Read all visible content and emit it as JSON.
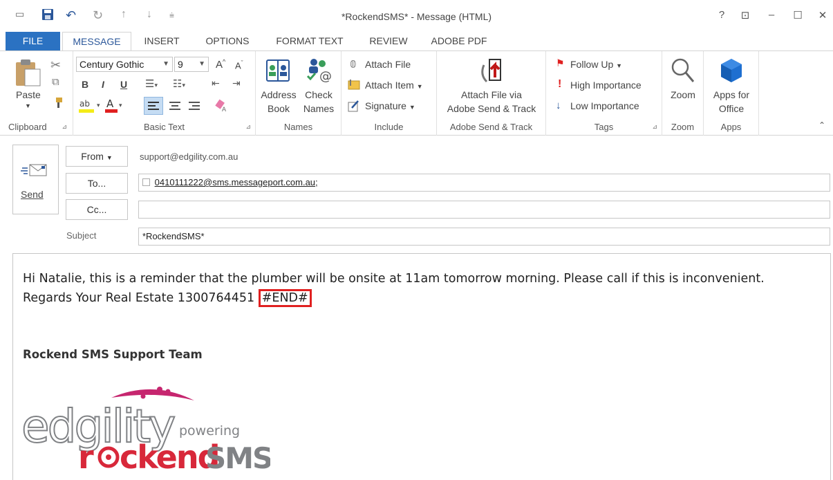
{
  "window": {
    "title": "*RockendSMS* - Message (HTML)",
    "help": "?",
    "restore": "⊡",
    "minimize": "–",
    "maximize": "☐",
    "close": "✕"
  },
  "tabs": [
    {
      "label": "FILE"
    },
    {
      "label": "MESSAGE"
    },
    {
      "label": "INSERT"
    },
    {
      "label": "OPTIONS"
    },
    {
      "label": "FORMAT TEXT"
    },
    {
      "label": "REVIEW"
    },
    {
      "label": "ADOBE PDF"
    }
  ],
  "ribbon": {
    "clipboard": {
      "paste": "Paste",
      "label": "Clipboard"
    },
    "basic_text": {
      "font": "Century Gothic",
      "size": "9",
      "bold": "B",
      "italic": "I",
      "underline": "U",
      "label": "Basic Text"
    },
    "names": {
      "address_book_1": "Address",
      "address_book_2": "Book",
      "check_names_1": "Check",
      "check_names_2": "Names",
      "label": "Names"
    },
    "include": {
      "attach_file": "Attach File",
      "attach_item": "Attach Item",
      "signature": "Signature",
      "label": "Include"
    },
    "adobe": {
      "line1": "Attach File via",
      "line2": "Adobe Send & Track",
      "label": "Adobe Send & Track"
    },
    "tags": {
      "follow_up": "Follow Up",
      "high": "High Importance",
      "low": "Low Importance",
      "label": "Tags"
    },
    "zoom": {
      "button": "Zoom",
      "label": "Zoom"
    },
    "apps": {
      "line1": "Apps for",
      "line2": "Office",
      "label": "Apps"
    }
  },
  "compose": {
    "send": "Send",
    "from_btn": "From",
    "from_value": "support@edgility.com.au",
    "to_btn": "To...",
    "to_value": "0410111222@sms.messageport.com.au;",
    "cc_btn": "Cc...",
    "cc_value": "",
    "subject_label": "Subject",
    "subject_value": "*RockendSMS*"
  },
  "body": {
    "text_main": "Hi Natalie, this is a reminder that the plumber will be onsite at 11am tomorrow morning. Please call if this is inconvenient. Regards Your Real Estate 1300764451",
    "end_tag": "#END#",
    "signature": "Rockend SMS Support Team",
    "logo": {
      "edgility": "edgility",
      "powering": "powering",
      "rockend_r": "r",
      "rockend_rest": "ckend",
      "sms": "SMS"
    }
  },
  "colors": {
    "accent": "#2b579a",
    "file_tab": "#2b72c2",
    "highlight": "#e02020",
    "logo_red": "#d8283a",
    "logo_pink": "#c6266f",
    "logo_gray": "#808285"
  }
}
